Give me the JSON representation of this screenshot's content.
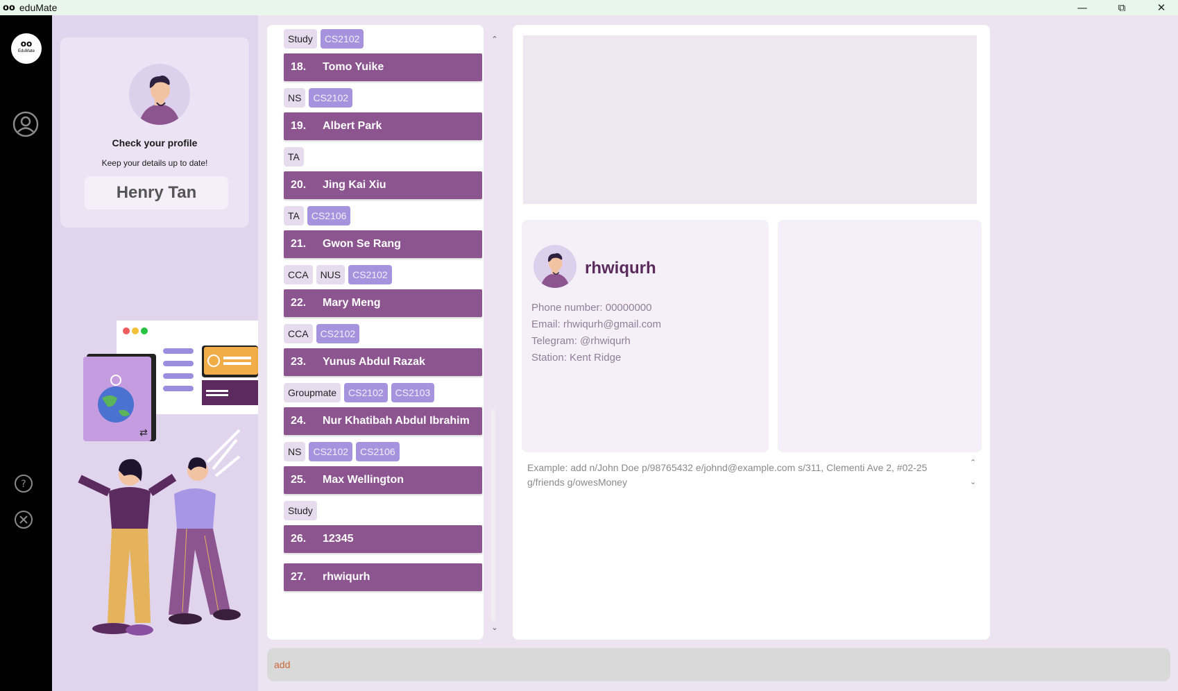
{
  "window": {
    "logo": "oo",
    "title": "eduMate",
    "minimize_icon": "minimize-icon",
    "restore_icon": "restore-icon",
    "close_icon": "close-icon"
  },
  "sidebar": {
    "logo_mark": "oo",
    "logo_text": "EduMate",
    "icons": [
      "profile-icon",
      "help-icon",
      "exit-icon"
    ]
  },
  "profile": {
    "title": "Check your profile",
    "subtitle": "Keep your details up to date!",
    "name": "Henry Tan"
  },
  "list": {
    "top_tags": [
      {
        "text": "Study",
        "kind": "cat"
      },
      {
        "text": "CS2102",
        "kind": "mod"
      }
    ],
    "people": [
      {
        "index": "18.",
        "name": "Tomo Yuike",
        "tags": [
          {
            "text": "NS",
            "kind": "cat"
          },
          {
            "text": "CS2102",
            "kind": "mod"
          }
        ]
      },
      {
        "index": "19.",
        "name": "Albert Park",
        "tags": [
          {
            "text": "TA",
            "kind": "cat"
          }
        ]
      },
      {
        "index": "20.",
        "name": "Jing Kai Xiu",
        "tags": [
          {
            "text": "TA",
            "kind": "cat"
          },
          {
            "text": "CS2106",
            "kind": "mod"
          }
        ]
      },
      {
        "index": "21.",
        "name": "Gwon Se Rang",
        "tags": [
          {
            "text": "CCA",
            "kind": "cat"
          },
          {
            "text": "NUS",
            "kind": "cat"
          },
          {
            "text": "CS2102",
            "kind": "mod"
          }
        ]
      },
      {
        "index": "22.",
        "name": "Mary Meng",
        "tags": [
          {
            "text": "CCA",
            "kind": "cat"
          },
          {
            "text": "CS2102",
            "kind": "mod"
          }
        ]
      },
      {
        "index": "23.",
        "name": "Yunus Abdul Razak",
        "tags": [
          {
            "text": "Groupmate",
            "kind": "cat"
          },
          {
            "text": "CS2102",
            "kind": "mod"
          },
          {
            "text": "CS2103",
            "kind": "mod"
          }
        ]
      },
      {
        "index": "24.",
        "name": "Nur Khatibah Abdul Ibrahim",
        "tags": [
          {
            "text": "NS",
            "kind": "cat"
          },
          {
            "text": "CS2102",
            "kind": "mod"
          },
          {
            "text": "CS2106",
            "kind": "mod"
          }
        ]
      },
      {
        "index": "25.",
        "name": "Max Wellington",
        "tags": [
          {
            "text": "Study",
            "kind": "cat"
          }
        ]
      },
      {
        "index": "26.",
        "name": "12345",
        "tags": []
      },
      {
        "index": "27.",
        "name": "rhwiqurh",
        "tags": []
      }
    ]
  },
  "detail": {
    "name": "rhwiqurh",
    "phone": "Phone number: 00000000",
    "email": "Email: rhwiqurh@gmail.com",
    "telegram": "Telegram: @rhwiqurh",
    "station": "Station: Kent Ridge"
  },
  "result": {
    "text": "Example: add n/John Doe p/98765432 e/johnd@example.com s/311, Clementi Ave 2, #02-25 g/friends g/owesMoney"
  },
  "command": {
    "value": "add"
  },
  "colors": {
    "accent": "#8c5590",
    "module_tag": "#a693de",
    "category_tag": "#e6dcee",
    "sidebar": "#000000",
    "command_text": "#c9693a"
  }
}
